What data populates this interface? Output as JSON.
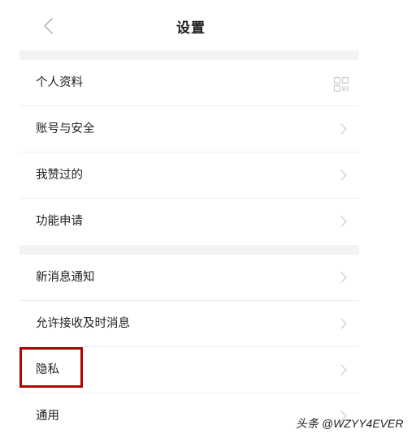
{
  "header": {
    "title": "设置"
  },
  "groups": [
    {
      "items": [
        {
          "label": "个人资料",
          "trailing": "qr-code-icon"
        },
        {
          "label": "账号与安全",
          "trailing": "chevron-right-icon"
        },
        {
          "label": "我赞过的",
          "trailing": "chevron-right-icon"
        },
        {
          "label": "功能申请",
          "trailing": "chevron-right-icon"
        }
      ]
    },
    {
      "items": [
        {
          "label": "新消息通知",
          "trailing": "chevron-right-icon"
        },
        {
          "label": "允许接收及时消息",
          "trailing": "chevron-right-icon"
        },
        {
          "label": "隐私",
          "trailing": "chevron-right-icon",
          "highlighted": true
        },
        {
          "label": "通用",
          "trailing": "chevron-right-icon"
        }
      ]
    }
  ],
  "watermark": "头条 @WZYY4EVER",
  "colors": {
    "highlight": "#b30000",
    "separator": "#f3f3f3",
    "chevron": "#c8c8c8"
  }
}
